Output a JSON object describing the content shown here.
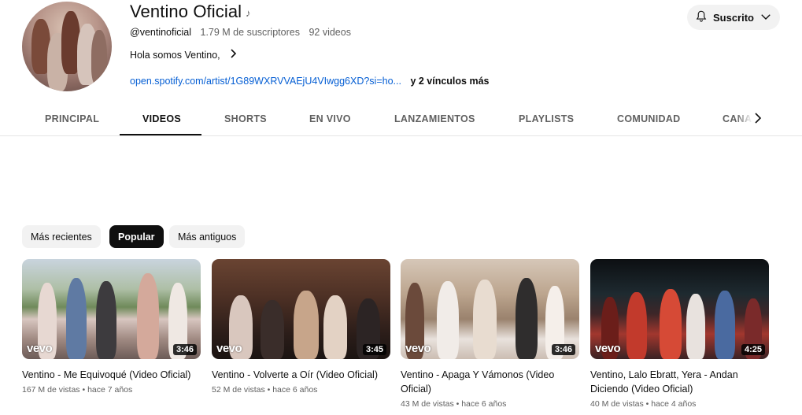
{
  "channel": {
    "name": "Ventino Oficial",
    "handle": "@ventinoficial",
    "subscribers": "1.79 M de suscriptores",
    "videos_count": "92 videos",
    "description": "Hola somos Ventino,",
    "link_url": "open.spotify.com/artist/1G89WXRVVAEjU4VIwgg6XD?si=ho...",
    "link_more": "y 2 vínculos más",
    "subscribe_label": "Suscrito"
  },
  "tabs": [
    {
      "label": "PRINCIPAL",
      "active": false
    },
    {
      "label": "VIDEOS",
      "active": true
    },
    {
      "label": "SHORTS",
      "active": false
    },
    {
      "label": "EN VIVO",
      "active": false
    },
    {
      "label": "LANZAMIENTOS",
      "active": false
    },
    {
      "label": "PLAYLISTS",
      "active": false
    },
    {
      "label": "COMUNIDAD",
      "active": false
    },
    {
      "label": "CANALES",
      "active": false
    }
  ],
  "chips": [
    {
      "label": "Más recientes",
      "active": false
    },
    {
      "label": "Popular",
      "active": true
    },
    {
      "label": "Más antiguos",
      "active": false
    }
  ],
  "videos": [
    {
      "title": "Ventino - Me Equivoqué (Video Oficial)",
      "duration": "3:46",
      "views": "167 M de vistas",
      "age": "hace 7 años",
      "badge": "vevo",
      "watched_fraction": 0
    },
    {
      "title": "Ventino - Volverte a Oír (Video Oficial)",
      "duration": "3:45",
      "views": "52 M de vistas",
      "age": "hace 6 años",
      "badge": "vevo",
      "watched_fraction": 0
    },
    {
      "title": "Ventino - Apaga Y Vámonos (Video Oficial)",
      "duration": "3:46",
      "views": "43 M de vistas",
      "age": "hace 6 años",
      "badge": "vevo",
      "watched_fraction": 0
    },
    {
      "title": "Ventino, Lalo Ebratt, Yera - Andan Diciendo (Video Oficial)",
      "duration": "4:25",
      "views": "40 M de vistas",
      "age": "hace 4 años",
      "badge": "vevo",
      "watched_fraction": 0
    }
  ],
  "icons": {
    "music_note": "music-note-icon",
    "bell": "bell-icon",
    "chevron_down": "chevron-down-icon",
    "chevron_right": "chevron-right-icon"
  },
  "colors": {
    "link": "#065fd4",
    "text": "#0f0f0f",
    "secondary_text": "#606060",
    "chip_bg": "#f2f2f2",
    "chip_active_bg": "#0f0f0f"
  }
}
